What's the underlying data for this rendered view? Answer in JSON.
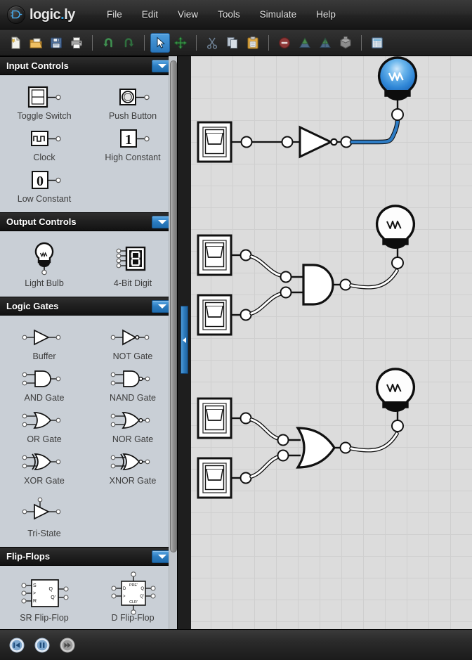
{
  "app": {
    "logo_text": "logic",
    "logo_dot": ".",
    "logo_tld": "ly"
  },
  "menubar": {
    "items": [
      {
        "label": "File",
        "icon": "menu-file"
      },
      {
        "label": "Edit",
        "icon": "menu-edit"
      },
      {
        "label": "View",
        "icon": "menu-view"
      },
      {
        "label": "Tools",
        "icon": "menu-tools"
      },
      {
        "label": "Simulate",
        "icon": "menu-simulate"
      },
      {
        "label": "Help",
        "icon": "menu-help"
      }
    ]
  },
  "toolbar": {
    "buttons": [
      {
        "name": "new-document-button",
        "icon": "new-document-icon",
        "active": false
      },
      {
        "name": "open-file-button",
        "icon": "open-folder-icon",
        "active": false
      },
      {
        "name": "save-button",
        "icon": "floppy-disk-icon",
        "active": false
      },
      {
        "name": "print-button",
        "icon": "printer-icon",
        "active": false
      },
      {
        "name": "undo-button",
        "icon": "undo-arrow-icon",
        "active": false
      },
      {
        "name": "redo-button",
        "icon": "redo-arrow-icon",
        "active": false
      },
      {
        "name": "select-tool-button",
        "icon": "cursor-arrow-icon",
        "active": true
      },
      {
        "name": "pan-tool-button",
        "icon": "move-cross-icon",
        "active": false
      },
      {
        "name": "cut-button",
        "icon": "scissors-icon",
        "active": false
      },
      {
        "name": "copy-button",
        "icon": "copy-pages-icon",
        "active": false
      },
      {
        "name": "paste-button",
        "icon": "clipboard-icon",
        "active": false
      },
      {
        "name": "delete-button",
        "icon": "delete-circle-icon",
        "active": false
      },
      {
        "name": "bring-forward-button",
        "icon": "layer-up-icon",
        "active": false
      },
      {
        "name": "send-backward-button",
        "icon": "layer-down-icon",
        "active": false
      },
      {
        "name": "group-button",
        "icon": "package-cube-icon",
        "active": false
      },
      {
        "name": "properties-button",
        "icon": "properties-panel-icon",
        "active": false
      }
    ],
    "separators_after": [
      3,
      5,
      7,
      10,
      14
    ]
  },
  "sidebar": {
    "sections": [
      {
        "title": "Input Controls",
        "collapse_icon": "caret-down-icon",
        "items": [
          {
            "label": "Toggle Switch",
            "icon": "toggle-switch-icon"
          },
          {
            "label": "Push Button",
            "icon": "push-button-icon"
          },
          {
            "label": "Clock",
            "icon": "clock-pulse-icon"
          },
          {
            "label": "High Constant",
            "icon": "constant-one-icon"
          },
          {
            "label": "Low Constant",
            "icon": "constant-zero-icon"
          }
        ]
      },
      {
        "title": "Output Controls",
        "collapse_icon": "caret-down-icon",
        "items": [
          {
            "label": "Light Bulb",
            "icon": "light-bulb-icon"
          },
          {
            "label": "4-Bit Digit",
            "icon": "seven-segment-digit-icon"
          }
        ]
      },
      {
        "title": "Logic Gates",
        "collapse_icon": "caret-down-icon",
        "items": [
          {
            "label": "Buffer",
            "icon": "buffer-gate-icon"
          },
          {
            "label": "NOT Gate",
            "icon": "not-gate-icon"
          },
          {
            "label": "AND Gate",
            "icon": "and-gate-icon"
          },
          {
            "label": "NAND Gate",
            "icon": "nand-gate-icon"
          },
          {
            "label": "OR Gate",
            "icon": "or-gate-icon"
          },
          {
            "label": "NOR Gate",
            "icon": "nor-gate-icon"
          },
          {
            "label": "XOR Gate",
            "icon": "xor-gate-icon"
          },
          {
            "label": "XNOR Gate",
            "icon": "xnor-gate-icon"
          },
          {
            "label": "Tri-State",
            "icon": "tri-state-buffer-icon"
          }
        ]
      },
      {
        "title": "Flip-Flops",
        "collapse_icon": "caret-down-icon",
        "items": [
          {
            "label": "SR Flip-Flop",
            "icon": "sr-flip-flop-icon",
            "pins": [
              "S",
              ">",
              "R",
              "Q",
              "Q'"
            ]
          },
          {
            "label": "D Flip-Flop",
            "icon": "d-flip-flop-icon",
            "pins": [
              "PRE'",
              "D",
              ">",
              "Q",
              "Q'",
              "CLR'"
            ]
          }
        ]
      }
    ],
    "scrollbar": {
      "name": "sidebar-vertical-scrollbar"
    }
  },
  "splitter": {
    "name": "panel-splitter",
    "icon": "collapse-left-arrow-icon"
  },
  "canvas": {
    "name": "circuit-canvas",
    "grid_color": "#cfcfcf",
    "background_color": "#dcdcdc",
    "active_wire_color": "#2f7cc4",
    "lit_bulb_color": "#3f9fe8",
    "circuits": [
      {
        "name": "not-gate-circuit",
        "inputs": [
          {
            "type": "toggle-switch",
            "state": "off"
          }
        ],
        "gate": "NOT",
        "output": {
          "type": "light-bulb",
          "state": "on"
        }
      },
      {
        "name": "and-gate-circuit",
        "inputs": [
          {
            "type": "toggle-switch",
            "state": "off"
          },
          {
            "type": "toggle-switch",
            "state": "off"
          }
        ],
        "gate": "AND",
        "output": {
          "type": "light-bulb",
          "state": "off"
        }
      },
      {
        "name": "or-gate-circuit",
        "inputs": [
          {
            "type": "toggle-switch",
            "state": "off"
          },
          {
            "type": "toggle-switch",
            "state": "off"
          }
        ],
        "gate": "OR",
        "output": {
          "type": "light-bulb",
          "state": "off"
        }
      }
    ]
  },
  "statusbar": {
    "buttons": [
      {
        "name": "restart-simulation-button",
        "icon": "skip-back-icon"
      },
      {
        "name": "pause-simulation-button",
        "icon": "pause-icon"
      },
      {
        "name": "step-simulation-button",
        "icon": "fast-forward-icon"
      }
    ]
  }
}
